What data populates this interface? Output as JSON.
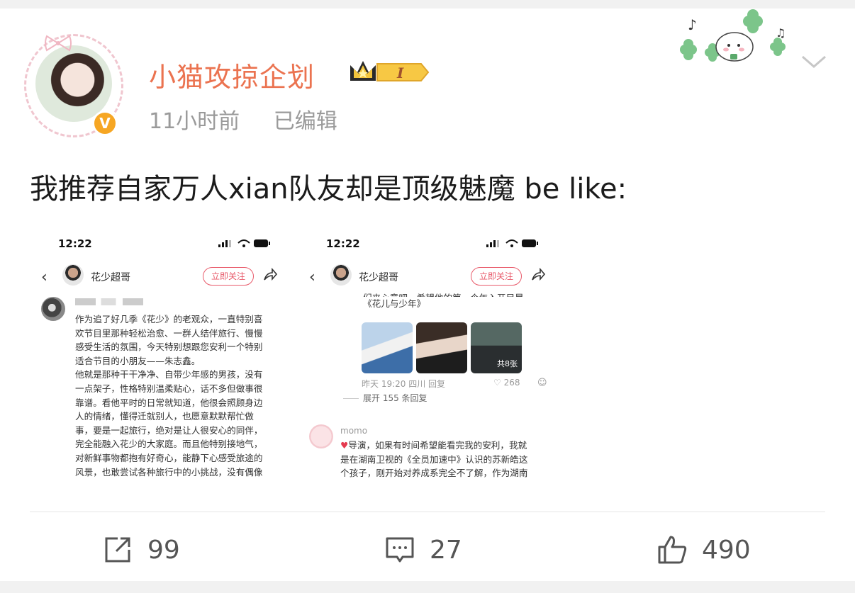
{
  "post": {
    "username": "小猫攻掠企划",
    "level_badge": "I",
    "time": "11小时前",
    "edited": "已编辑",
    "text": "我推荐自家万人xian队友却是顶级魅魔 be like:"
  },
  "screenshot1": {
    "time": "12:22",
    "account": "花少超哥",
    "follow": "立即关注",
    "comment_lines": [
      "作为追了好几季《花少》的老观众，一直特别喜",
      "欢节目里那种轻松治愈、一群人结伴旅行、慢慢",
      "感受生活的氛围，今天特别想跟您安利一个特别",
      "适合节目的小朋友——朱志鑫。",
      "他就是那种干干净净、自带少年感的男孩，没有",
      "一点架子，性格特别温柔贴心，话不多但做事很",
      "靠谱。看他平时的日常就知道，他很会照顾身边",
      "人的情绪，懂得迁就别人，也愿意默默帮忙做",
      "事，要是一起旅行，绝对是让人很安心的同伴，",
      "完全能融入花少的大家庭。而且他特别接地气，",
      "对新鲜事物都抱有好奇心，能静下心感受旅途的",
      "风景，也敢尝试各种旅行中的小挑战，没有偶像"
    ]
  },
  "screenshot2": {
    "time": "12:22",
    "account": "花少超哥",
    "follow": "立即关注",
    "partial_line": "们来心意吧。希望他的第一个年入开另是",
    "show_title": "《花儿与少年》",
    "image_count": "共8张",
    "comment_meta": "昨天 19:20 四川   回复",
    "likes": "268",
    "expand": "展开 155 条回复",
    "commenter": "momo",
    "reply_lines": [
      "导演，如果有时间希望能看完我的安利，我就",
      "是在湖南卫视的《全员加速中》认识的苏新皓这",
      "个孩子，刚开始对养成系完全不了解，作为湖南"
    ]
  },
  "actions": {
    "repost_count": "99",
    "comment_count": "27",
    "like_count": "490"
  },
  "icons": {
    "verify": "verified-badge-icon",
    "crown": "crown-level-icon",
    "more": "chevron-down-icon",
    "repost": "repost-icon",
    "comment": "comment-icon",
    "like": "thumbs-up-icon"
  },
  "colors": {
    "username": "#eb7350",
    "meta": "#9a9a9a",
    "follow_accent": "#e85a6a",
    "badge_gold": "#f6a623"
  }
}
